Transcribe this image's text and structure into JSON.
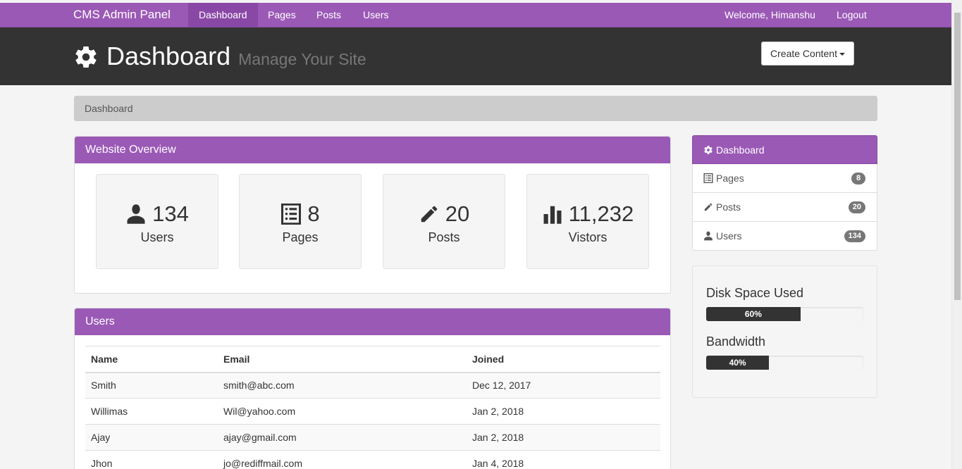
{
  "navbar": {
    "brand": "CMS Admin Panel",
    "items": [
      {
        "label": "Dashboard",
        "active": true
      },
      {
        "label": "Pages",
        "active": false
      },
      {
        "label": "Posts",
        "active": false
      },
      {
        "label": "Users",
        "active": false
      }
    ],
    "welcome": "Welcome, Himanshu",
    "logout": "Logout"
  },
  "header": {
    "icon": "gear-icon",
    "title": "Dashboard",
    "subtitle": "Manage Your Site",
    "create_button": "Create Content"
  },
  "breadcrumb": "Dashboard",
  "overview": {
    "heading": "Website Overview",
    "cards": [
      {
        "icon": "user-icon",
        "value": "134",
        "label": "Users"
      },
      {
        "icon": "list-icon",
        "value": "8",
        "label": "Pages"
      },
      {
        "icon": "pencil-icon",
        "value": "20",
        "label": "Posts"
      },
      {
        "icon": "stats-icon",
        "value": "11,232",
        "label": "Vistors"
      }
    ]
  },
  "users": {
    "heading": "Users",
    "columns": [
      "Name",
      "Email",
      "Joined"
    ],
    "rows": [
      [
        "Smith",
        "smith@abc.com",
        "Dec 12, 2017"
      ],
      [
        "Willimas",
        "Wil@yahoo.com",
        "Jan 2, 2018"
      ],
      [
        "Ajay",
        "ajay@gmail.com",
        "Jan 2, 2018"
      ],
      [
        "Jhon",
        "jo@rediffmail.com",
        "Jan 4, 2018"
      ]
    ]
  },
  "sidebar": {
    "items": [
      {
        "icon": "gear-icon",
        "label": "Dashboard",
        "badge": ""
      },
      {
        "icon": "list-icon",
        "label": "Pages",
        "badge": "8"
      },
      {
        "icon": "pencil-icon",
        "label": "Posts",
        "badge": "20"
      },
      {
        "icon": "user-icon",
        "label": "Users",
        "badge": "134"
      }
    ]
  },
  "usage": {
    "disk": {
      "label": "Disk Space Used",
      "percent": 60,
      "text": "60%"
    },
    "bandwidth": {
      "label": "Bandwidth",
      "percent": 40,
      "text": "40%"
    }
  },
  "colors": {
    "accent": "#9b59b6",
    "header_bg": "#333333",
    "progress": "#333333"
  }
}
